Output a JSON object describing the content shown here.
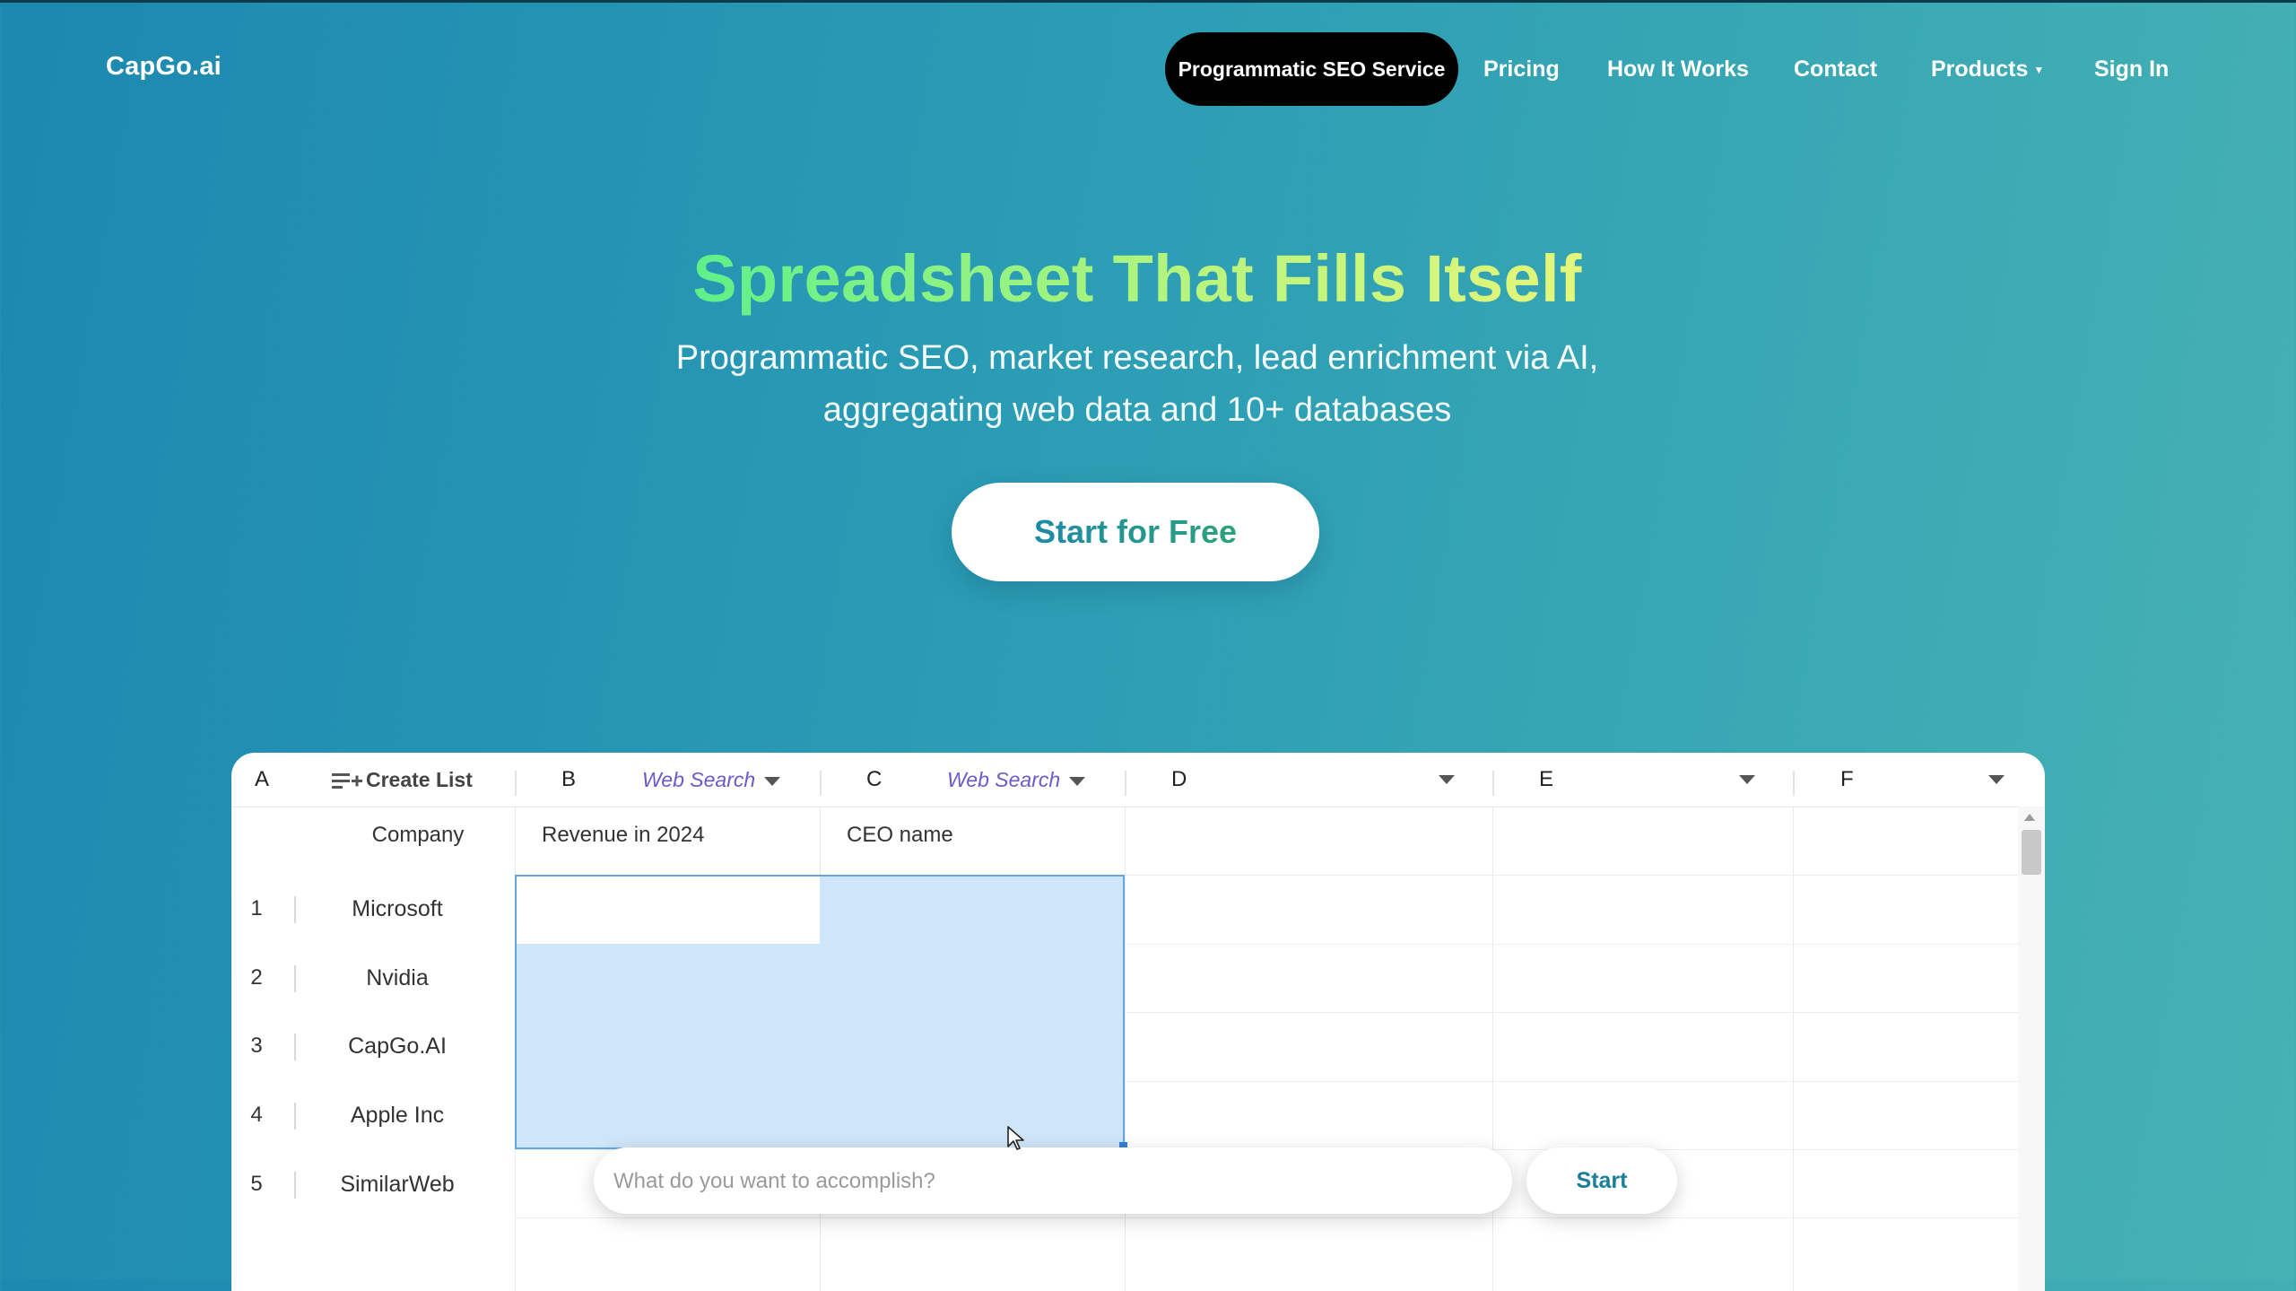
{
  "brand": {
    "logo_text": "CapGo.ai"
  },
  "nav": {
    "highlight": "Programmatic SEO Service",
    "items": [
      "Pricing",
      "How It Works",
      "Contact",
      "Products",
      "Sign In"
    ]
  },
  "hero": {
    "title": "Spreadsheet That Fills Itself",
    "subtitle_line1": "Programmatic SEO, market research, lead enrichment via AI,",
    "subtitle_line2": "aggregating web data and 10+ databases",
    "cta": "Start for Free"
  },
  "sheet": {
    "create_list_label": "Create List",
    "columns": [
      {
        "letter": "A",
        "label": "Company"
      },
      {
        "letter": "B",
        "label": "Revenue in 2024",
        "source": "Web Search"
      },
      {
        "letter": "C",
        "label": "CEO name",
        "source": "Web Search"
      },
      {
        "letter": "D",
        "label": ""
      },
      {
        "letter": "E",
        "label": ""
      },
      {
        "letter": "F",
        "label": ""
      }
    ],
    "rows": [
      {
        "num": "1",
        "company": "Microsoft"
      },
      {
        "num": "2",
        "company": "Nvidia"
      },
      {
        "num": "3",
        "company": "CapGo.AI"
      },
      {
        "num": "4",
        "company": "Apple Inc"
      },
      {
        "num": "5",
        "company": "SimilarWeb"
      }
    ],
    "prompt_placeholder": "What do you want to accomplish?",
    "start_label": "Start"
  },
  "colors": {
    "bg_start": "#1d88b0",
    "bg_end": "#47b2b5",
    "title_gradient_start": "#5ef08a",
    "title_gradient_end": "#e5f77a",
    "selection": "#cfe6f8",
    "web_search": "#6a5acd"
  }
}
